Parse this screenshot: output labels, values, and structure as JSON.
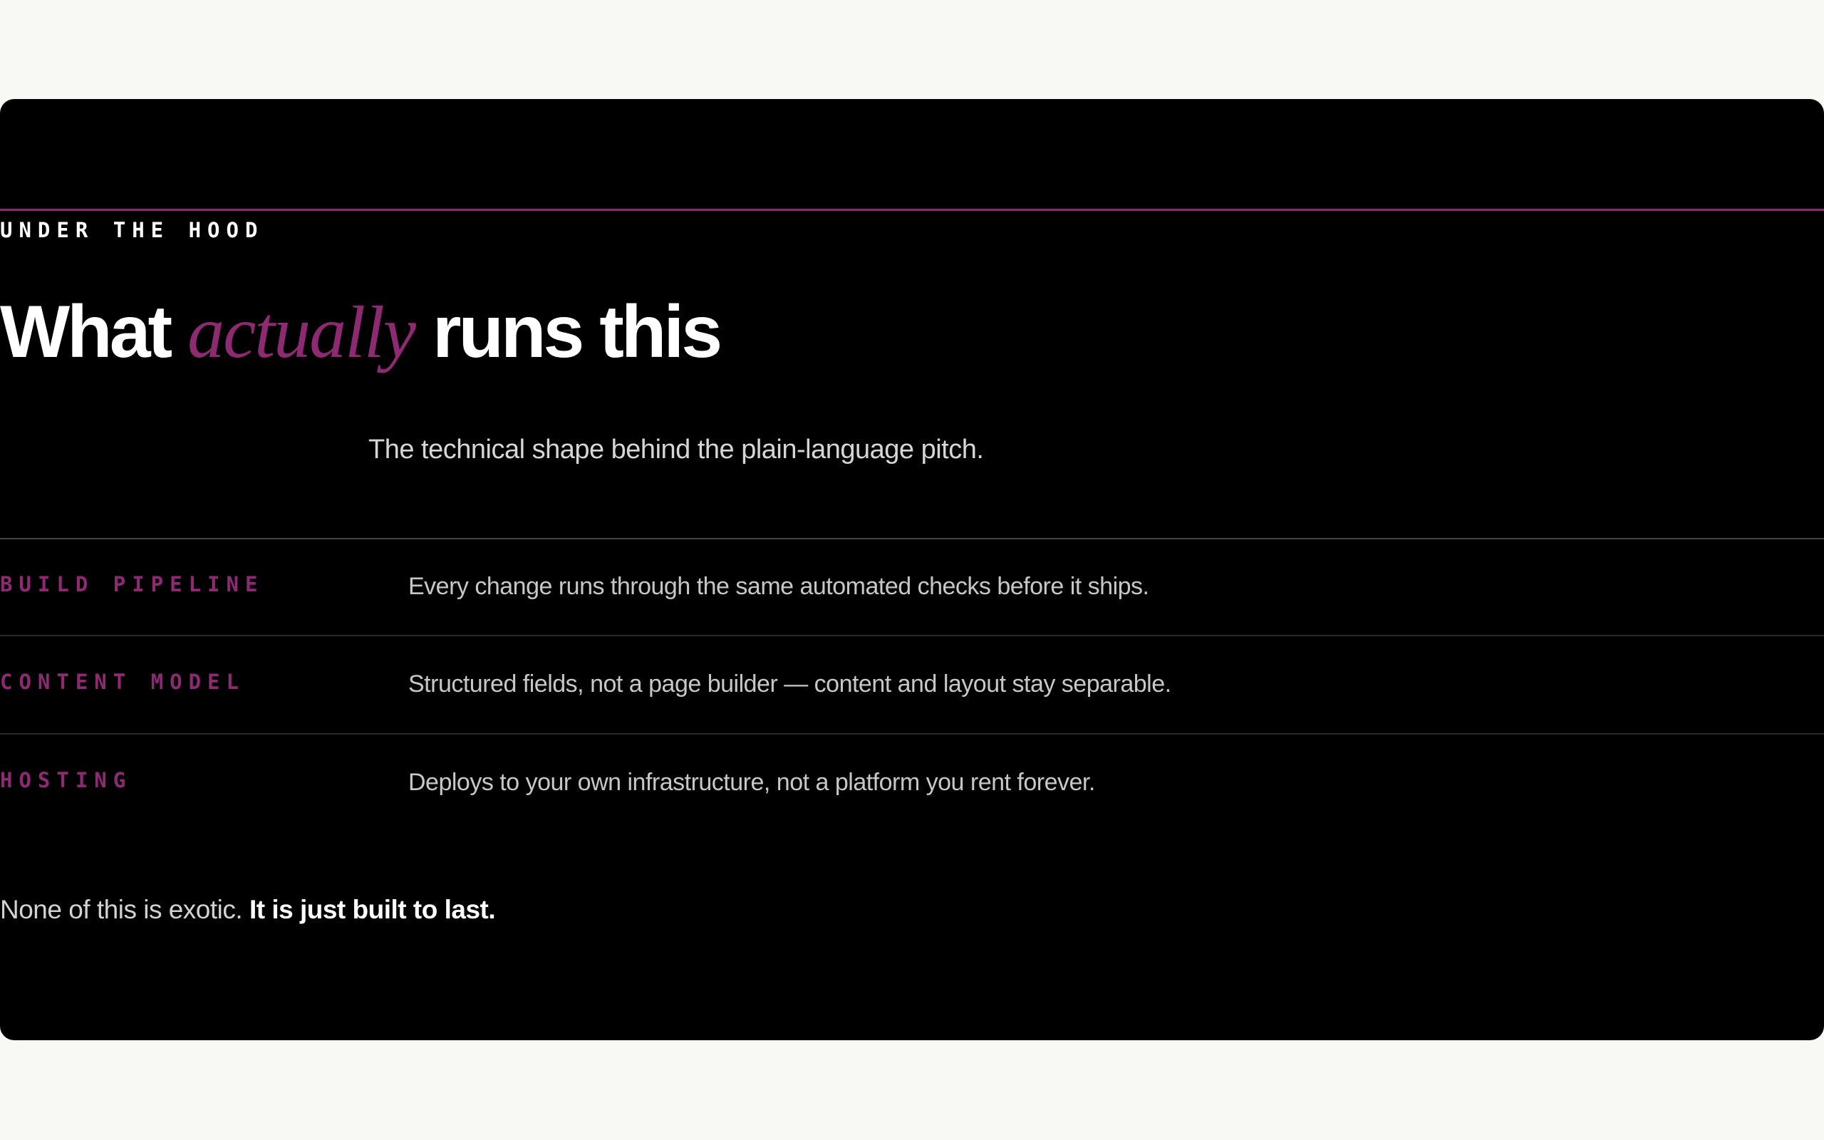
{
  "section": {
    "eyebrow": "UNDER THE HOOD",
    "headline": {
      "before": "What ",
      "accent": "actually",
      "after": " runs this"
    },
    "subtitle": "The technical shape behind the plain-language pitch."
  },
  "specs": [
    {
      "label": "BUILD PIPELINE",
      "description": "Every change runs through the same automated checks before it ships."
    },
    {
      "label": "CONTENT MODEL",
      "description": "Structured fields, not a page builder — content and layout stay separable."
    },
    {
      "label": "HOSTING",
      "description": "Deploys to your own infrastructure, not a platform you rent forever."
    }
  ],
  "closing": {
    "plain": "None of this is exotic. ",
    "bold": "It is just built to last."
  },
  "colors": {
    "page_background": "#f8f9f4",
    "card_background": "#000000",
    "accent": "#8e2a72",
    "heading_text": "#ffffff",
    "body_text": "#c7c7c7"
  }
}
